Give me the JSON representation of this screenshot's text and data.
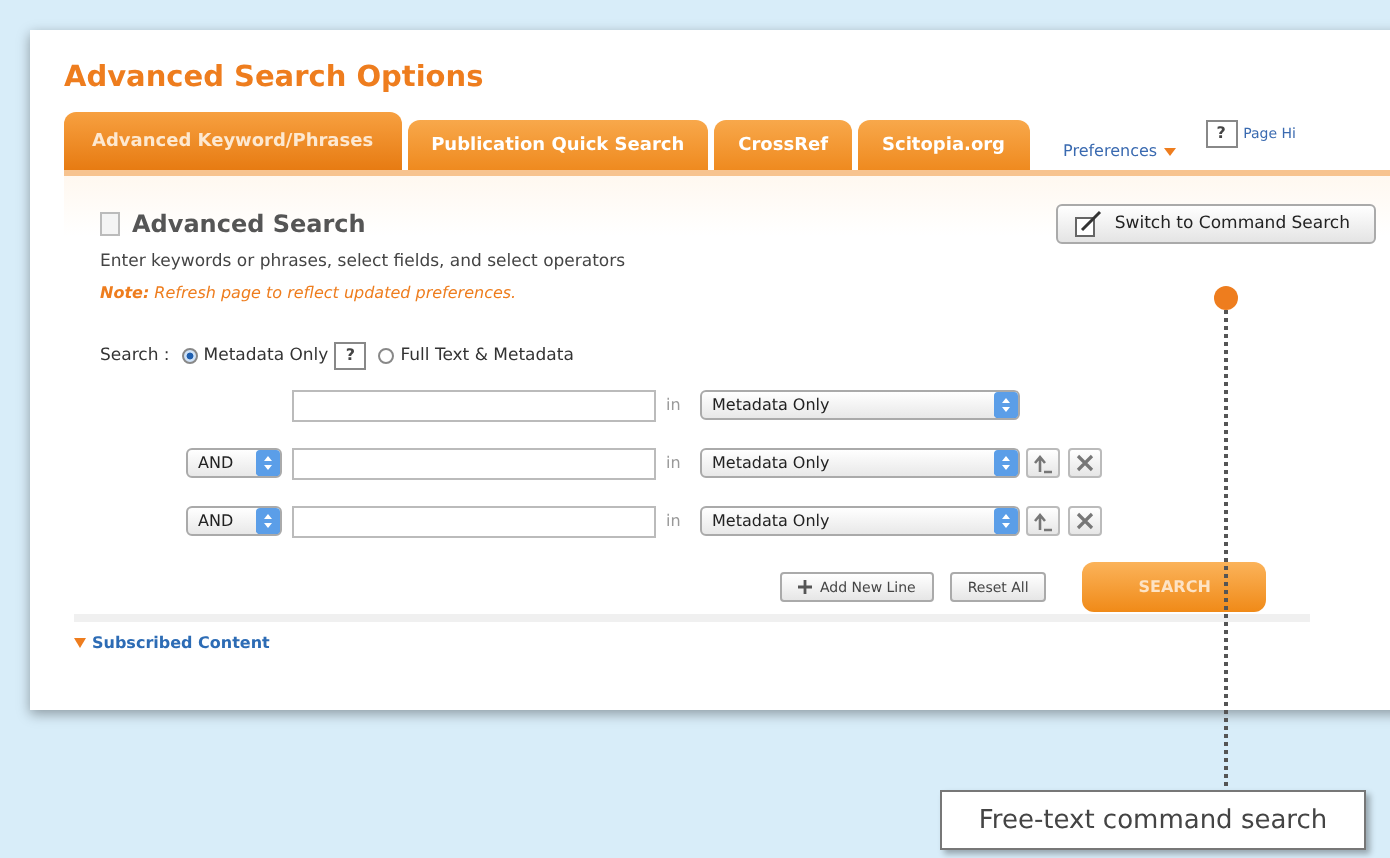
{
  "title": "Advanced Search Options",
  "tabs": [
    {
      "label": "Advanced Keyword/Phrases",
      "selected": true
    },
    {
      "label": "Publication Quick Search",
      "selected": false
    },
    {
      "label": "CrossRef",
      "selected": false
    },
    {
      "label": "Scitopia.org",
      "selected": false
    }
  ],
  "preferences": "Preferences",
  "page_help": {
    "icon": "?",
    "label": "Page Hi"
  },
  "heading": "Advanced Search",
  "instructions": "Enter keywords or phrases, select fields, and select operators",
  "note": "**Note:** Refresh page to reflect updated preferences.",
  "switch_button": "Switch to Command Search",
  "search_scope": {
    "label": "Search :",
    "help": "?",
    "options": [
      {
        "label": "Metadata Only",
        "selected": true
      },
      {
        "label": "Full Text & Metadata",
        "selected": false
      }
    ]
  },
  "rows": [
    {
      "kind": "first",
      "in_label": "in",
      "field": "Metadata Only"
    },
    {
      "kind": "added",
      "operator": "AND",
      "in_label": "in",
      "field": "Metadata Only"
    },
    {
      "kind": "added",
      "operator": "AND",
      "in_label": "in",
      "field": "Metadata Only"
    }
  ],
  "add_line_button": "Add New Line",
  "reset_button": "Reset All",
  "search_button": "SEARCH",
  "subscribed_content": "Subscribed Content",
  "callout": "Free-text command search"
}
